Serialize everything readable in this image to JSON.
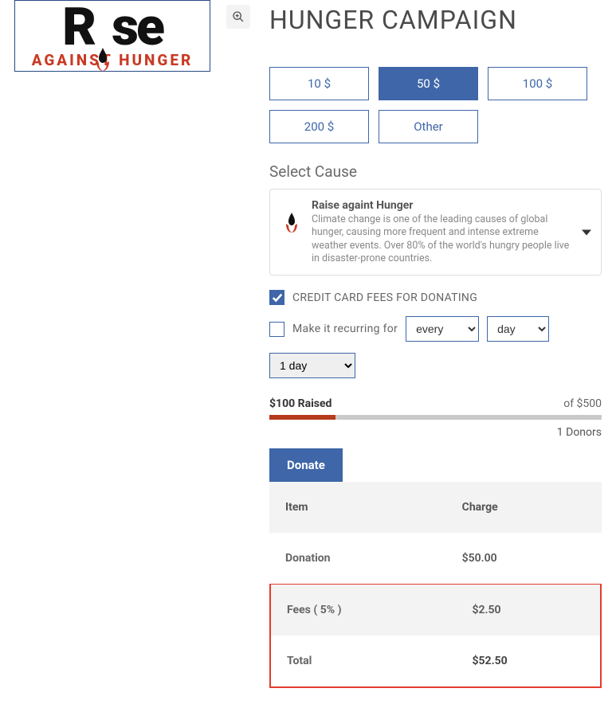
{
  "logo": {
    "line1_prefix": "R",
    "line1_suffix": "se",
    "line2": "AGAINST HUNGER"
  },
  "title": "HUNGER CAMPAIGN",
  "amounts": [
    {
      "label": "10 $",
      "selected": false
    },
    {
      "label": "50 $",
      "selected": true
    },
    {
      "label": "100 $",
      "selected": false
    },
    {
      "label": "200 $",
      "selected": false
    },
    {
      "label": "Other",
      "selected": false
    }
  ],
  "select_cause_label": "Select Cause",
  "cause": {
    "title": "Raise againt Hunger",
    "desc": "Climate change is one of the leading causes of global hunger, causing more frequent and intense extreme weather events. Over 80% of the world's hungry people live in disaster-prone countries."
  },
  "cc_fees_label": "CREDIT CARD FEES FOR DONATING",
  "cc_fees_checked": true,
  "recurring_label": "Make it recurring for",
  "recurring_checked": false,
  "recurring_freq_selected": "every",
  "recurring_unit_selected": "day",
  "recurring_period_selected": "1 day",
  "progress": {
    "raised_label": "$100 Raised",
    "goal_label": "of $500",
    "percent": 20,
    "donors": "1 Donors"
  },
  "donate_tab": "Donate",
  "summary": {
    "head_item": "Item",
    "head_charge": "Charge",
    "donation_label": "Donation",
    "donation_amount": "$50.00",
    "fees_label": "Fees ( 5% )",
    "fees_amount": "$2.50",
    "total_label": "Total",
    "total_amount": "$52.50"
  }
}
